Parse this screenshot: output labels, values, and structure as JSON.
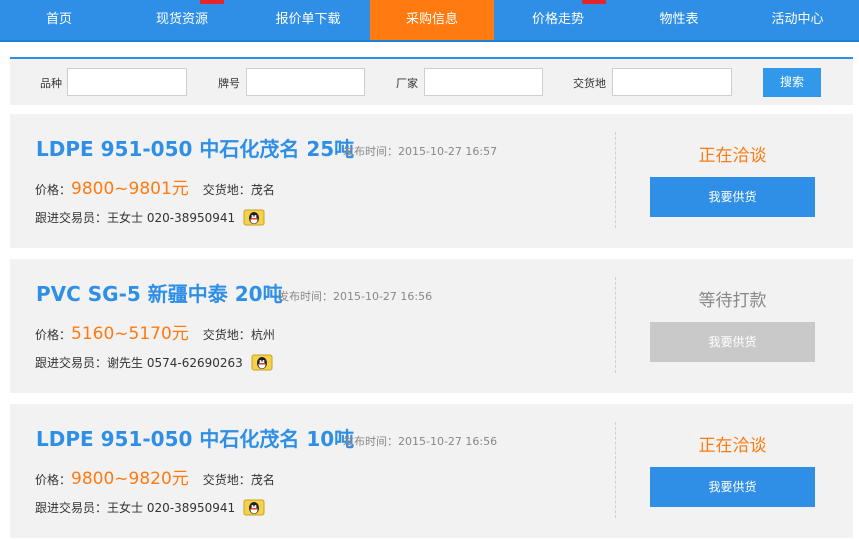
{
  "nav": {
    "items": [
      {
        "label": "首页"
      },
      {
        "label": "现货资源"
      },
      {
        "label": "报价单下载"
      },
      {
        "label": "采购信息"
      },
      {
        "label": "价格走势"
      },
      {
        "label": "物性表"
      },
      {
        "label": "活动中心"
      }
    ],
    "active_index": 3,
    "colors": {
      "bar": "#2f8fe6",
      "active": "#ff7a10",
      "badge": "#e2262b"
    }
  },
  "search": {
    "variety_label": "品种",
    "brand_label": "牌号",
    "maker_label": "厂家",
    "delivery_label": "交货地",
    "button_label": "搜索"
  },
  "listings": [
    {
      "title": "LDPE 951-050 中石化茂名 25吨",
      "time": "发布时间：2015-10-27 16:57",
      "price_label": "价格：",
      "price": "9800~9801元",
      "dest_label": "交货地：",
      "dest": "茂名",
      "trader_label": "跟进交易员：",
      "trader": "王女士 020-38950941",
      "status": "正在洽谈",
      "action": "我要供货"
    },
    {
      "title": "PVC SG-5 新疆中泰 20吨",
      "time": "发布时间：2015-10-27 16:56",
      "price_label": "价格：",
      "price": "5160~5170元",
      "dest_label": "交货地：",
      "dest": "杭州",
      "trader_label": "跟进交易员：",
      "trader": "谢先生 0574-62690263",
      "status": "等待打款",
      "action": "我要供货"
    },
    {
      "title": "LDPE 951-050 中石化茂名 10吨",
      "time": "发布时间：2015-10-27 16:56",
      "price_label": "价格：",
      "price": "9800~9820元",
      "dest_label": "交货地：",
      "dest": "茂名",
      "trader_label": "跟进交易员：",
      "trader": "王女士 020-38950941",
      "status": "正在洽谈",
      "action": "我要供货"
    }
  ]
}
